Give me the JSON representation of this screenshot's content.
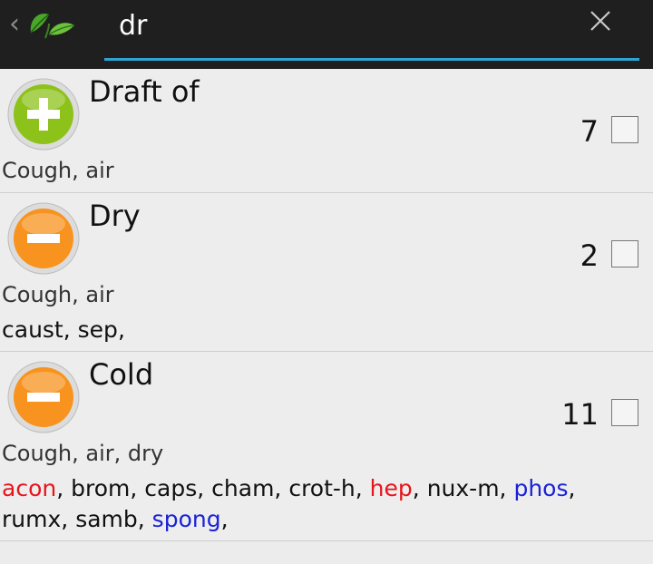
{
  "search": {
    "value": "dr",
    "placeholder": ""
  },
  "colors": {
    "accent": "#2fa3d3",
    "remedy_red": "#e8141b",
    "remedy_blue": "#1a22d6",
    "plus_green": "#8cc21a",
    "minus_orange": "#f7931e"
  },
  "rows": [
    {
      "icon": "plus-icon",
      "title": "Draft of",
      "count": "7",
      "subtitle": "Cough, air",
      "checked": false,
      "remedies": []
    },
    {
      "icon": "minus-icon",
      "title": "Dry",
      "count": "2",
      "subtitle": "Cough, air",
      "checked": false,
      "remedies": [
        {
          "name": "caust",
          "color": "default"
        },
        {
          "name": "sep",
          "color": "default"
        }
      ]
    },
    {
      "icon": "minus-icon",
      "title": "Cold",
      "count": "11",
      "subtitle": "Cough, air, dry",
      "checked": false,
      "remedies": [
        {
          "name": "acon",
          "color": "red"
        },
        {
          "name": "brom",
          "color": "default"
        },
        {
          "name": "caps",
          "color": "default"
        },
        {
          "name": "cham",
          "color": "default"
        },
        {
          "name": "crot-h",
          "color": "default"
        },
        {
          "name": "hep",
          "color": "red"
        },
        {
          "name": "nux-m",
          "color": "default"
        },
        {
          "name": "phos",
          "color": "blue"
        },
        {
          "name": "rumx",
          "color": "default"
        },
        {
          "name": "samb",
          "color": "default"
        },
        {
          "name": "spong",
          "color": "blue"
        }
      ]
    }
  ]
}
